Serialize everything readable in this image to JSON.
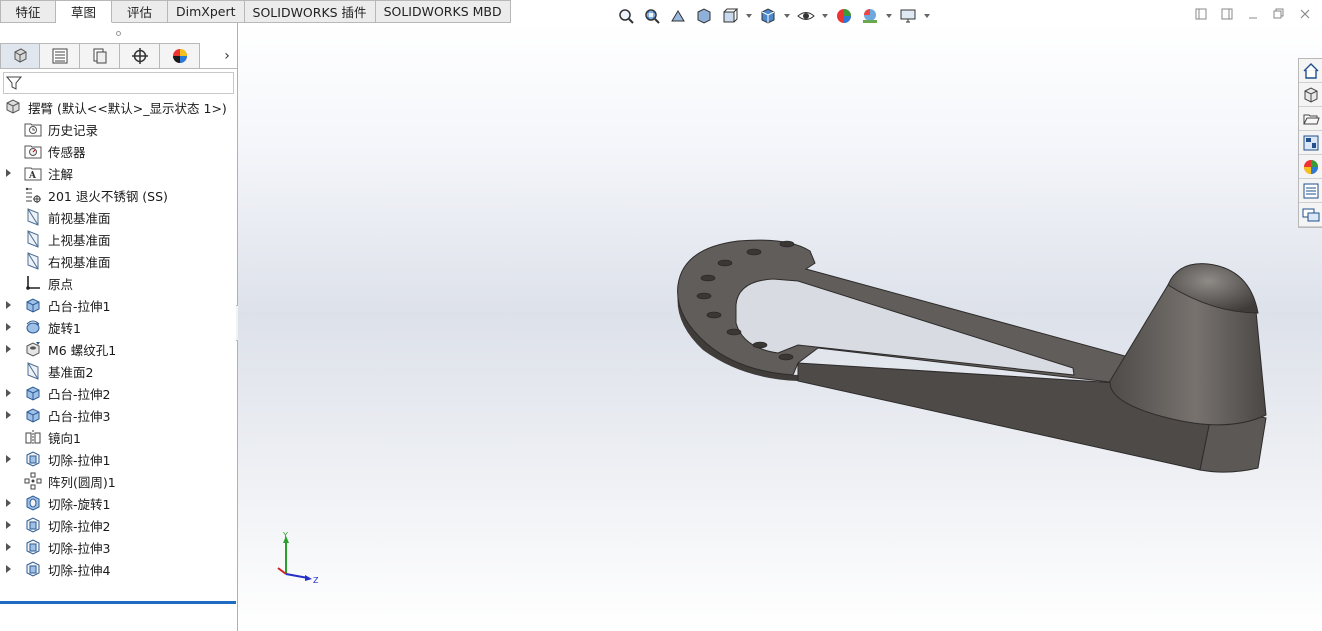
{
  "tabs": [
    {
      "label": "特征",
      "active": false
    },
    {
      "label": "草图",
      "active": true
    },
    {
      "label": "评估",
      "active": false
    },
    {
      "label": "DimXpert",
      "active": false
    },
    {
      "label": "SOLIDWORKS 插件",
      "active": false
    },
    {
      "label": "SOLIDWORKS MBD",
      "active": false
    }
  ],
  "manager_more": "›",
  "tree": {
    "root_label": "摆臂 (默认<<默认>_显示状态 1>)",
    "items": [
      {
        "label": "历史记录",
        "icon": "history-folder-icon",
        "expandable": false
      },
      {
        "label": "传感器",
        "icon": "sensor-folder-icon",
        "expandable": false
      },
      {
        "label": "注解",
        "icon": "annotation-folder-icon",
        "expandable": true
      },
      {
        "label": "201 退火不锈钢 (SS)",
        "icon": "material-icon",
        "expandable": false
      },
      {
        "label": "前视基准面",
        "icon": "plane-icon",
        "expandable": false
      },
      {
        "label": "上视基准面",
        "icon": "plane-icon",
        "expandable": false
      },
      {
        "label": "右视基准面",
        "icon": "plane-icon",
        "expandable": false
      },
      {
        "label": "原点",
        "icon": "origin-icon",
        "expandable": false
      },
      {
        "label": "凸台-拉伸1",
        "icon": "boss-extrude-icon",
        "expandable": true
      },
      {
        "label": "旋转1",
        "icon": "revolve-icon",
        "expandable": true
      },
      {
        "label": "M6 螺纹孔1",
        "icon": "hole-wizard-icon",
        "expandable": true
      },
      {
        "label": "基准面2",
        "icon": "plane-icon",
        "expandable": false
      },
      {
        "label": "凸台-拉伸2",
        "icon": "boss-extrude-icon",
        "expandable": true
      },
      {
        "label": "凸台-拉伸3",
        "icon": "boss-extrude-icon",
        "expandable": true
      },
      {
        "label": "镜向1",
        "icon": "mirror-icon",
        "expandable": false
      },
      {
        "label": "切除-拉伸1",
        "icon": "cut-extrude-icon",
        "expandable": true
      },
      {
        "label": "阵列(圆周)1",
        "icon": "circular-pattern-icon",
        "expandable": false
      },
      {
        "label": "切除-旋转1",
        "icon": "cut-revolve-icon",
        "expandable": true
      },
      {
        "label": "切除-拉伸2",
        "icon": "cut-extrude-icon",
        "expandable": true
      },
      {
        "label": "切除-拉伸3",
        "icon": "cut-extrude-icon",
        "expandable": true
      },
      {
        "label": "切除-拉伸4",
        "icon": "cut-extrude-icon",
        "expandable": true
      }
    ]
  },
  "triad": {
    "y_label": "Y",
    "z_label": "Z"
  },
  "colors": {
    "accent": "#1f6bc1",
    "part": "#5e5a57"
  }
}
